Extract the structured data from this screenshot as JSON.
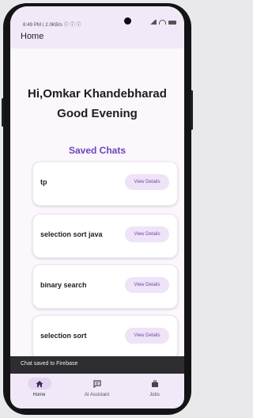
{
  "status_bar": {
    "time": "8:49 PM | 2.0KB/s ⓘ ⓘ ⓘ",
    "icons": [
      "signal-icon",
      "wifi-icon",
      "battery-icon"
    ]
  },
  "app_bar": {
    "title": "Home"
  },
  "greeting": {
    "line1": "Hi,Omkar Khandebharad",
    "line2": "Good Evening"
  },
  "saved_chats": {
    "title": "Saved Chats",
    "items": [
      {
        "label": "tp",
        "button": "View Details"
      },
      {
        "label": "selection sort java",
        "button": "View Details"
      },
      {
        "label": "binary search",
        "button": "View Details"
      },
      {
        "label": "selection sort",
        "button": "View Details"
      }
    ]
  },
  "snackbar": {
    "text": "Chat saved to Firebase"
  },
  "bottom_nav": {
    "items": [
      {
        "label": "Home",
        "icon": "home-icon",
        "active": true
      },
      {
        "label": "AI Assistant",
        "icon": "chat-icon",
        "active": false
      },
      {
        "label": "Jobs",
        "icon": "briefcase-icon",
        "active": false
      }
    ]
  },
  "colors": {
    "accent": "#6e45b8",
    "surface": "#f1e9f7",
    "button_bg": "#efe3f7",
    "snackbar": "#2d2c31"
  }
}
